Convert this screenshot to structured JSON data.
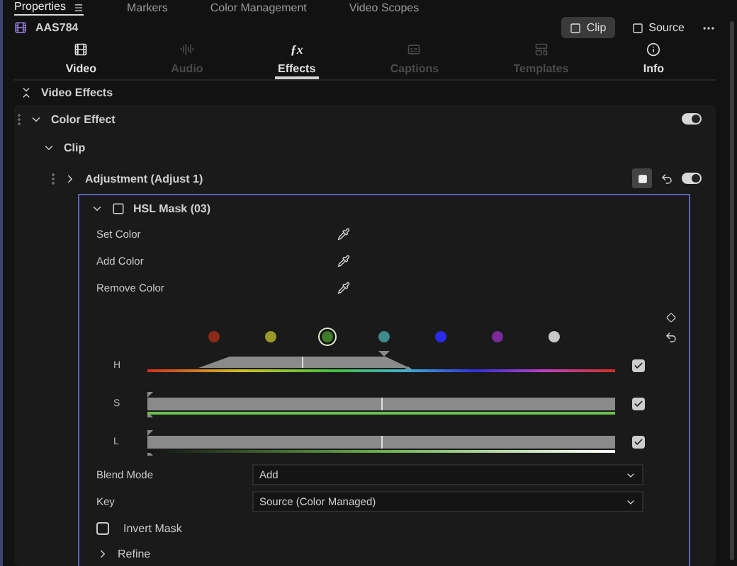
{
  "top_tabs": [
    {
      "label": "Properties",
      "selected": true
    },
    {
      "label": "Markers",
      "selected": false
    },
    {
      "label": "Color Management",
      "selected": false
    },
    {
      "label": "Video Scopes",
      "selected": false
    }
  ],
  "clip": {
    "name": "AAS784"
  },
  "view_buttons": [
    {
      "label": "Clip",
      "selected": true
    },
    {
      "label": "Source",
      "selected": false
    }
  ],
  "tabs": [
    {
      "label": "Video",
      "kind": "video",
      "selected": false,
      "disabled": false
    },
    {
      "label": "Audio",
      "kind": "audio",
      "selected": false,
      "disabled": true
    },
    {
      "label": "Effects",
      "kind": "fx",
      "icon": "ƒx",
      "selected": true,
      "disabled": false
    },
    {
      "label": "Captions",
      "kind": "captions",
      "selected": false,
      "disabled": true
    },
    {
      "label": "Templates",
      "kind": "templates",
      "selected": false,
      "disabled": true
    },
    {
      "label": "Info",
      "kind": "info",
      "selected": false,
      "disabled": false
    }
  ],
  "section_title": "Video Effects",
  "effect": {
    "title": "Color Effect",
    "expanded": true,
    "on": true
  },
  "clip_group": {
    "title": "Clip",
    "expanded": true
  },
  "adjustment": {
    "title": "Adjustment (Adjust 1)",
    "expanded": false,
    "on": true
  },
  "mask": {
    "title": "HSL Mask (03)",
    "expanded": true,
    "pickers": [
      "Set Color",
      "Add Color",
      "Remove Color"
    ],
    "swatches": [
      {
        "color": "#8c2a18",
        "selected": false
      },
      {
        "color": "#9a9a2a",
        "selected": false
      },
      {
        "color": "#3e7a28",
        "selected": true
      },
      {
        "color": "#3f8a8a",
        "selected": false
      },
      {
        "color": "#2a2ae8",
        "selected": false
      },
      {
        "color": "#7a2a9a",
        "selected": false
      },
      {
        "color": "#c8c8c8",
        "selected": false
      }
    ],
    "channels": [
      {
        "label": "H",
        "kind": "hue",
        "checked": true,
        "level": 0.33
      },
      {
        "label": "S",
        "kind": "saturation",
        "checked": true,
        "level": 0.5
      },
      {
        "label": "L",
        "kind": "luminance",
        "checked": true,
        "level": 0.5
      }
    ],
    "fields": [
      {
        "label": "Blend Mode",
        "value": "Add"
      },
      {
        "label": "Key",
        "value": "Source (Color Managed)"
      }
    ],
    "invert": {
      "label": "Invert Mask",
      "checked": false
    },
    "refine": {
      "label": "Refine",
      "expanded": false
    }
  }
}
